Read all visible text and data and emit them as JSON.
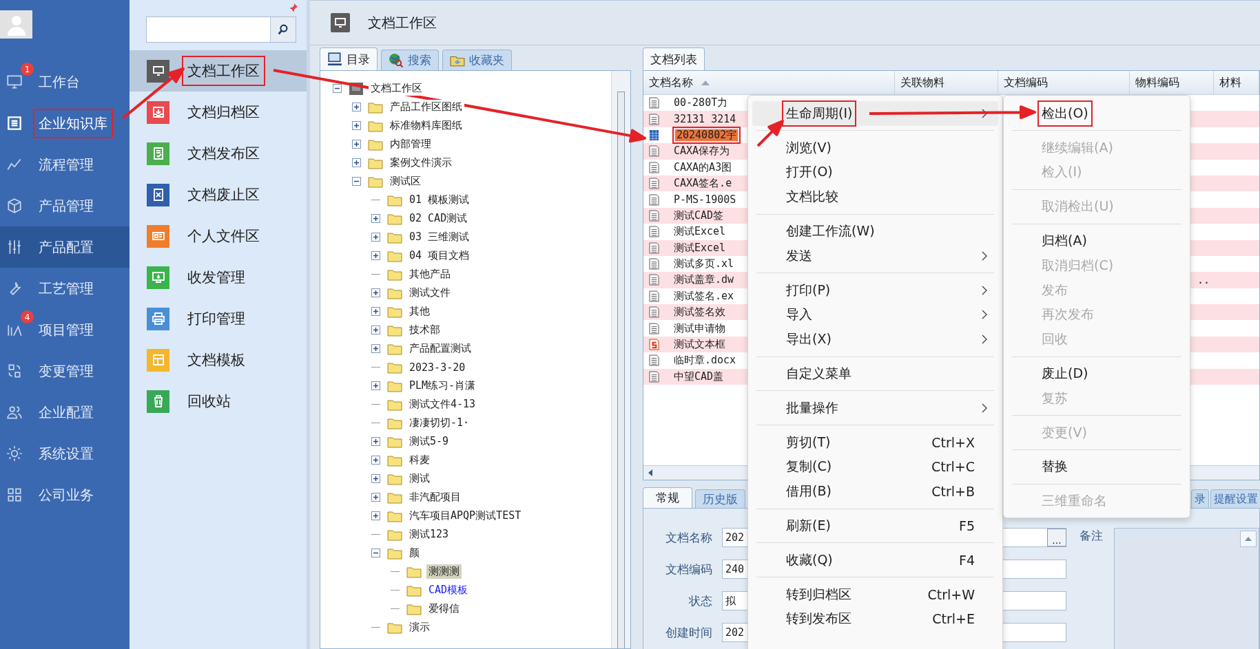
{
  "nav": {
    "items": [
      {
        "label": "工作台",
        "badge": "1",
        "selected": false,
        "annotated": false
      },
      {
        "label": "企业知识库",
        "selected": true,
        "annotated": true
      },
      {
        "label": "流程管理",
        "selected": false,
        "annotated": false
      },
      {
        "label": "产品管理",
        "selected": false,
        "annotated": false
      },
      {
        "label": "产品配置",
        "selected": false,
        "hovered": true,
        "annotated": false
      },
      {
        "label": "工艺管理",
        "selected": false,
        "annotated": false
      },
      {
        "label": "项目管理",
        "badge": "4",
        "selected": false,
        "annotated": false
      },
      {
        "label": "变更管理",
        "selected": false,
        "annotated": false
      },
      {
        "label": "企业配置",
        "selected": false,
        "annotated": false
      },
      {
        "label": "系统设置",
        "selected": false,
        "annotated": false
      },
      {
        "label": "公司业务",
        "selected": false,
        "annotated": false
      }
    ]
  },
  "module_panel": {
    "items": [
      {
        "label": "文档工作区",
        "color": "#5b5b5b",
        "selected": true,
        "annotated": true
      },
      {
        "label": "文档归档区",
        "color": "#e84a4f",
        "selected": false,
        "annotated": false
      },
      {
        "label": "文档发布区",
        "color": "#4cae4f",
        "selected": false,
        "annotated": false
      },
      {
        "label": "文档废止区",
        "color": "#2f5fae",
        "selected": false,
        "annotated": false
      },
      {
        "label": "个人文件区",
        "color": "#f07d2c",
        "selected": false,
        "annotated": false
      },
      {
        "label": "收发管理",
        "color": "#3bb44d",
        "selected": false,
        "annotated": false
      },
      {
        "label": "打印管理",
        "color": "#4a8fd6",
        "selected": false,
        "annotated": false
      },
      {
        "label": "文档模板",
        "color": "#f3b62c",
        "selected": false,
        "annotated": false
      },
      {
        "label": "回收站",
        "color": "#39a857",
        "selected": false,
        "annotated": false
      }
    ]
  },
  "header": {
    "title": "文档工作区"
  },
  "tree_panel": {
    "tabs": [
      {
        "label": "目录",
        "selected": true
      },
      {
        "label": "搜索",
        "selected": false
      },
      {
        "label": "收藏夹",
        "selected": false
      }
    ],
    "tree": [
      {
        "label": "文档工作区",
        "kind": "root",
        "expanded": true,
        "selected": false,
        "children": [
          {
            "label": "产品工作区图纸",
            "expanded": false,
            "selected": false
          },
          {
            "label": "标准物料库图纸",
            "expanded": false,
            "selected": false
          },
          {
            "label": "内部管理",
            "expanded": false,
            "selected": false
          },
          {
            "label": "案例文件演示",
            "expanded": false,
            "selected": false
          },
          {
            "label": "测试区",
            "expanded": true,
            "selected": false,
            "children": [
              {
                "label": "01 模板测试",
                "selected": false
              },
              {
                "label": "02 CAD测试",
                "expanded": false,
                "selected": false
              },
              {
                "label": "03 三维测试",
                "expanded": false,
                "selected": false
              },
              {
                "label": "04 项目文档",
                "expanded": false,
                "selected": false
              },
              {
                "label": "其他产品",
                "selected": false
              },
              {
                "label": "测试文件",
                "expanded": false,
                "selected": false
              },
              {
                "label": "其他",
                "expanded": false,
                "selected": false
              },
              {
                "label": "技术部",
                "expanded": false,
                "selected": false
              },
              {
                "label": "产品配置测试",
                "expanded": false,
                "selected": false
              },
              {
                "label": "2023-3-20",
                "selected": false
              },
              {
                "label": "PLM练习-肖潇",
                "expanded": false,
                "selected": false
              },
              {
                "label": "测试文件4-13",
                "selected": false
              },
              {
                "label": "凄凄切切-1·",
                "selected": false
              },
              {
                "label": "测试5-9",
                "expanded": false,
                "selected": false
              },
              {
                "label": "科麦",
                "expanded": false,
                "selected": false
              },
              {
                "label": "测试",
                "expanded": false,
                "selected": false
              },
              {
                "label": "非汽配项目",
                "expanded": false,
                "selected": false
              },
              {
                "label": "汽车项目APQP测试TEST",
                "expanded": false,
                "selected": false
              },
              {
                "label": "测试123",
                "selected": false
              },
              {
                "label": "颜",
                "expanded": true,
                "selected": false,
                "children": [
                  {
                    "label": "测测测",
                    "selected": true
                  },
                  {
                    "label": "CAD模板",
                    "selected": false,
                    "hot": true
                  },
                  {
                    "label": "爱得信",
                    "selected": false
                  }
                ]
              },
              {
                "label": "演示",
                "selected": false
              }
            ]
          }
        ]
      }
    ]
  },
  "document_list": {
    "tab": "文档列表",
    "columns": [
      "文档名称",
      "关联物料",
      "文档编码",
      "物料编码",
      "材料"
    ],
    "rows": [
      {
        "name": "00-280T力",
        "kind": "doc",
        "selected": false
      },
      {
        "name": "32131 3214",
        "kind": "doc",
        "selected": false
      },
      {
        "name": "20240802宇",
        "kind": "sheet",
        "selected": true,
        "annotated": true
      },
      {
        "name": "CAXA保存为",
        "kind": "doc",
        "selected": false
      },
      {
        "name": "CAXA的A3图",
        "kind": "doc",
        "selected": false
      },
      {
        "name": "CAXA签名.e",
        "kind": "doc",
        "selected": false
      },
      {
        "name": "P-MS-1900S",
        "kind": "doc",
        "selected": false
      },
      {
        "name": "测试CAD签",
        "kind": "doc",
        "selected": false
      },
      {
        "name": "测试Excel",
        "kind": "doc",
        "selected": false
      },
      {
        "name": "测试Excel",
        "kind": "doc",
        "selected": false
      },
      {
        "name": "测试多页.xl",
        "kind": "doc",
        "selected": false
      },
      {
        "name": "测试盖章.dw",
        "kind": "doc",
        "selected": false,
        "material_code": ".."
      },
      {
        "name": "测试签名.ex",
        "kind": "doc",
        "selected": false
      },
      {
        "name": "测试签名效",
        "kind": "doc",
        "selected": false
      },
      {
        "name": "测试申请物",
        "kind": "doc",
        "selected": false
      },
      {
        "name": "测试文本框",
        "kind": "stamp",
        "selected": false
      },
      {
        "name": "临时章.docx",
        "kind": "doc",
        "selected": false
      },
      {
        "name": "中望CAD盖",
        "kind": "doc",
        "selected": false
      }
    ]
  },
  "detail_panel": {
    "tabs": [
      {
        "label": "常规",
        "selected": true
      },
      {
        "label": "历史版",
        "selected": false
      },
      {
        "label": "录",
        "selected": false
      },
      {
        "label": "提醒设置",
        "selected": false
      }
    ],
    "fields": [
      {
        "label": "文档名称",
        "value": "202",
        "browse": "..."
      },
      {
        "label": "文档编码",
        "value": "240"
      },
      {
        "label": "状态",
        "value": "拟"
      },
      {
        "label": "创建时间",
        "value": "202"
      }
    ],
    "remark": {
      "label": "备注"
    }
  },
  "context_menu": {
    "groups": [
      {
        "items": [
          {
            "label": "生命周期(I)",
            "submenu": true,
            "open": true,
            "annotated": true,
            "disabled": false
          }
        ]
      },
      {
        "items": [
          {
            "label": "浏览(V)",
            "disabled": false
          },
          {
            "label": "打开(O)",
            "disabled": false
          },
          {
            "label": "文档比较",
            "disabled": false
          }
        ]
      },
      {
        "items": [
          {
            "label": "创建工作流(W)",
            "disabled": false
          },
          {
            "label": "发送",
            "submenu": true,
            "disabled": false
          }
        ]
      },
      {
        "items": [
          {
            "label": "打印(P)",
            "submenu": true,
            "disabled": false
          },
          {
            "label": "导入",
            "submenu": true,
            "disabled": false
          },
          {
            "label": "导出(X)",
            "submenu": true,
            "disabled": false
          }
        ]
      },
      {
        "items": [
          {
            "label": "自定义菜单",
            "disabled": false
          }
        ]
      },
      {
        "items": [
          {
            "label": "批量操作",
            "submenu": true,
            "disabled": false
          }
        ]
      },
      {
        "items": [
          {
            "label": "剪切(T)",
            "shortcut": "Ctrl+X",
            "disabled": false
          },
          {
            "label": "复制(C)",
            "shortcut": "Ctrl+C",
            "disabled": false
          },
          {
            "label": "借用(B)",
            "shortcut": "Ctrl+B",
            "disabled": false
          }
        ]
      },
      {
        "items": [
          {
            "label": "刷新(E)",
            "shortcut": "F5",
            "disabled": false
          }
        ]
      },
      {
        "items": [
          {
            "label": "收藏(Q)",
            "shortcut": "F4",
            "disabled": false
          }
        ]
      },
      {
        "items": [
          {
            "label": "转到归档区",
            "shortcut": "Ctrl+W",
            "disabled": false
          },
          {
            "label": "转到发布区",
            "shortcut": "Ctrl+E",
            "disabled": false
          }
        ]
      }
    ]
  },
  "lifecycle_submenu": {
    "groups": [
      {
        "items": [
          {
            "label": "检出(O)",
            "disabled": false,
            "annotated": true
          }
        ]
      },
      {
        "items": [
          {
            "label": "继续编辑(A)",
            "disabled": true
          },
          {
            "label": "检入(I)",
            "disabled": true
          }
        ]
      },
      {
        "items": [
          {
            "label": "取消检出(U)",
            "disabled": true
          }
        ]
      },
      {
        "items": [
          {
            "label": "归档(A)",
            "disabled": false
          },
          {
            "label": "取消归档(C)",
            "disabled": true
          },
          {
            "label": "发布",
            "disabled": true
          },
          {
            "label": "再次发布",
            "disabled": true
          },
          {
            "label": "回收",
            "disabled": true
          }
        ]
      },
      {
        "items": [
          {
            "label": "废止(D)",
            "disabled": false
          },
          {
            "label": "复苏",
            "disabled": true
          }
        ]
      },
      {
        "items": [
          {
            "label": "变更(V)",
            "disabled": true
          }
        ]
      },
      {
        "items": [
          {
            "label": "替换",
            "disabled": false
          }
        ]
      },
      {
        "items": [
          {
            "label": "三维重命名",
            "disabled": true
          }
        ]
      }
    ]
  }
}
